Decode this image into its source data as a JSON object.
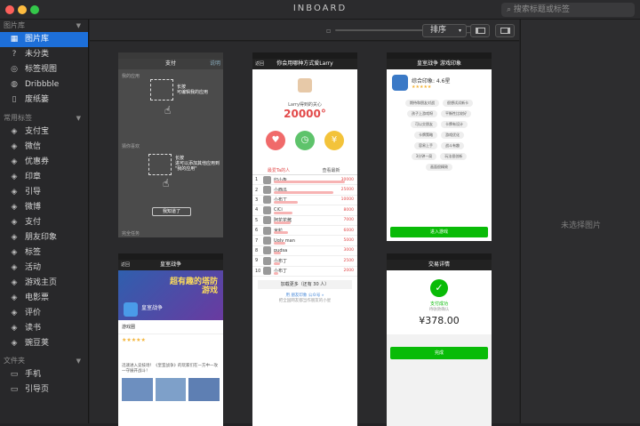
{
  "window": {
    "title": "INBOARD",
    "search_placeholder": "搜索标题或标签"
  },
  "colors": {
    "accent": "#1d6fd9",
    "close": "#fc605b",
    "minimize": "#fdbc40",
    "zoom": "#34c84a",
    "wechat_green": "#09bb07"
  },
  "sidebar": {
    "sec_library": "图片库",
    "library_items": [
      {
        "label": "图片库",
        "icon": "library-icon"
      },
      {
        "label": "未分类",
        "icon": "question-icon"
      },
      {
        "label": "标签视图",
        "icon": "tag-view-icon"
      },
      {
        "label": "Dribbble",
        "icon": "dribbble-icon"
      },
      {
        "label": "废纸篓",
        "icon": "trash-icon"
      }
    ],
    "sec_tags": "常用标签",
    "tag_items": [
      "支付宝",
      "微信",
      "优惠券",
      "印章",
      "引导",
      "微博",
      "支付",
      "朋友印象",
      "标签",
      "活动",
      "游戏主页",
      "电影票",
      "评价",
      "读书",
      "豌豆荚"
    ],
    "sec_folders": "文件夹",
    "folder_items": [
      "手机",
      "引导页"
    ]
  },
  "toolbar": {
    "sort_label": "排序"
  },
  "preview": {
    "empty_text": "未选择图片"
  },
  "thumbs": {
    "t1": {
      "nav": "支付",
      "nav_right": "说明",
      "section1": "我的应用",
      "tip1a": "长按",
      "tip1b": "可编辑我的应用",
      "section2": "猜你喜欢",
      "tip2a": "长按",
      "tip2b": "进可以添加其他应用到",
      "tip2c": "\"我的应用\"",
      "btn": "我知道了",
      "section3": "完全任务"
    },
    "t2": {
      "nav": "你会用哪种方式爱Larry",
      "back": "返回",
      "caption": "Larry得到的关心",
      "big": "20000°",
      "tab1": "最爱Ta的人",
      "tab2": "查看最新",
      "rows": [
        {
          "n": "1",
          "name": "印小象",
          "v": "30000"
        },
        {
          "n": "2",
          "name": "小西瓜",
          "v": "25000"
        },
        {
          "n": "3",
          "name": "小布丁",
          "v": "10000"
        },
        {
          "n": "4",
          "name": "CiCi",
          "v": "8000"
        },
        {
          "n": "5",
          "name": "阿花花酱",
          "v": "7000"
        },
        {
          "n": "6",
          "name": "米粒",
          "v": "6000"
        },
        {
          "n": "7",
          "name": "Ugly man",
          "v": "5000"
        },
        {
          "n": "8",
          "name": "pudsa",
          "v": "3000"
        },
        {
          "n": "9",
          "name": "小布丁",
          "v": "2500"
        },
        {
          "n": "10",
          "name": "小布丁",
          "v": "2000"
        }
      ],
      "more": "加载更多（还有 30 人）",
      "footer1": "用 朋友印象 公众号 »",
      "footer2": "把全国网友都当作朋友的小星"
    },
    "t3": {
      "nav": "皇室战争 游戏印象",
      "score": "综合印象: 4.6星",
      "btn": "进入游戏",
      "tags": [
        "期待和朋友对战",
        "很想试试新卡",
        "孩子上游戏呀",
        "平衡性比较好",
        "可以交朋友",
        "卡牌有设计",
        "卡牌策略",
        "游戏优化",
        "容易上手",
        "战斗有趣",
        "3分钟一局",
        "玩法很创新",
        "画面很精致"
      ]
    },
    "t4": {
      "nav": "皇室战争",
      "back": "返回",
      "banner": "超有趣的塔防游戏",
      "game": "皇室战争",
      "rating": "★★★★★",
      "section": "游戏圈",
      "intro": "迅速进入竞技场！《皇室战争》的玩家们在一方中一攻一守展开战斗！"
    },
    "t5": {
      "nav": "交易详情",
      "success": "支付成功",
      "sub": "待收款确认",
      "amount": "¥378.00",
      "btn": "完成"
    }
  }
}
